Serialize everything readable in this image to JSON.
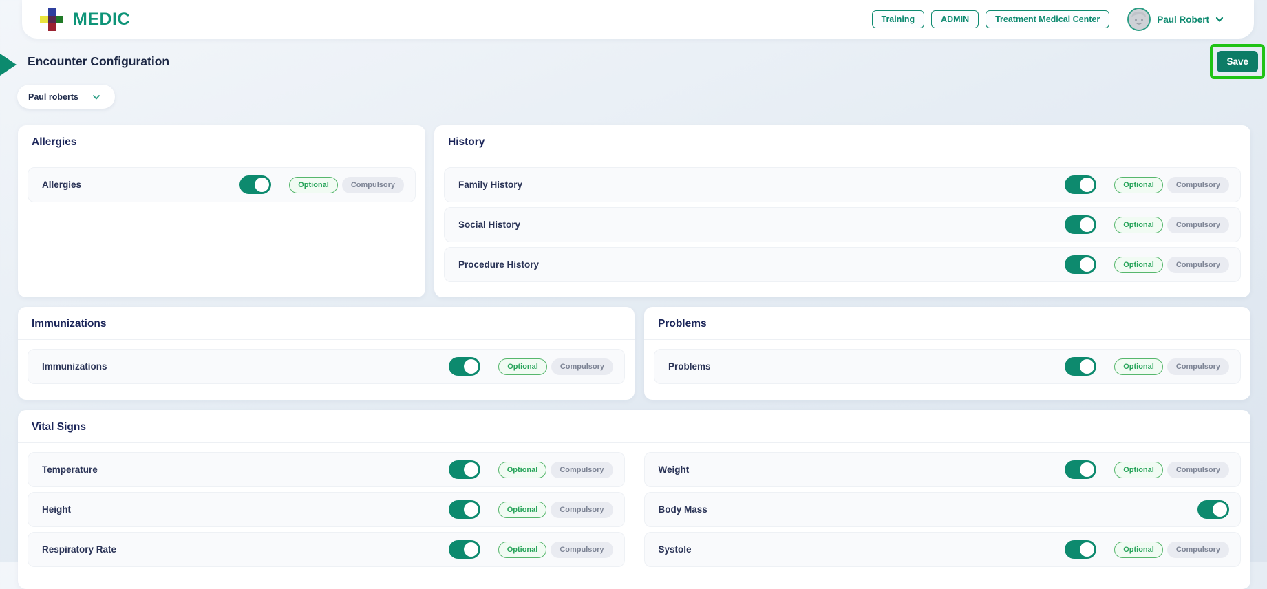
{
  "header": {
    "logo_text": "MEDIC",
    "nav_buttons": [
      {
        "label": "Training"
      },
      {
        "label": "ADMIN"
      },
      {
        "label": "Treatment Medical Center"
      }
    ],
    "user": {
      "name": "Paul Robert"
    }
  },
  "page": {
    "title": "Encounter Configuration",
    "save_label": "Save",
    "provider_dropdown": {
      "value": "Paul roberts"
    }
  },
  "badges": {
    "optional": "Optional",
    "compulsory": "Compulsory"
  },
  "cards": {
    "allergies": {
      "title": "Allergies",
      "rows": [
        {
          "label": "Allergies",
          "toggle": "on"
        }
      ]
    },
    "history": {
      "title": "History",
      "rows": [
        {
          "label": "Family History",
          "toggle": "on"
        },
        {
          "label": "Social History",
          "toggle": "on"
        },
        {
          "label": "Procedure History",
          "toggle": "on"
        }
      ]
    },
    "immunizations": {
      "title": "Immunizations",
      "rows": [
        {
          "label": "Immunizations",
          "toggle": "on"
        }
      ]
    },
    "problems": {
      "title": "Problems",
      "rows": [
        {
          "label": "Problems",
          "toggle": "on"
        }
      ]
    },
    "vital_signs": {
      "title": "Vital Signs",
      "rows": [
        {
          "label": "Temperature",
          "toggle": "on",
          "badges": true
        },
        {
          "label": "Weight",
          "toggle": "on",
          "badges": true
        },
        {
          "label": "Height",
          "toggle": "on",
          "badges": true
        },
        {
          "label": "Body Mass",
          "toggle": "on",
          "badges": false
        },
        {
          "label": "Respiratory Rate",
          "toggle": "on",
          "badges": true
        },
        {
          "label": "Systole",
          "toggle": "on",
          "badges": true
        }
      ]
    }
  },
  "colors": {
    "accent_teal": "#0d8a6e",
    "save_button": "#0d7c66",
    "save_highlight_green": "#1fc315",
    "optional_badge_text": "#27a45a",
    "compulsory_badge_bg": "#e9ebf1",
    "title_navy": "#1b2559"
  }
}
